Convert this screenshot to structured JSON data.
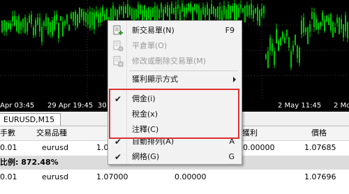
{
  "chart": {
    "time_labels": [
      "Apr 03:45",
      "29 Apr 19:45",
      "30",
      "2 May 11:45",
      "2 Mo"
    ]
  },
  "tab": {
    "label": "EURUSD,M15"
  },
  "table": {
    "headers": [
      "手數",
      "交易品種",
      "",
      "獲利",
      "價格"
    ],
    "rows": [
      [
        "0.01",
        "eurusd",
        "1.0",
        "",
        "1.07685"
      ],
      [
        "0.01",
        "eurusd",
        "1.07000",
        "0.00000",
        "1.07696"
      ]
    ],
    "ratio_label": "比例: 872.48%",
    "row1_extra": "0.00000",
    "row1_extra2": "0.00000"
  },
  "menu": {
    "items": [
      {
        "label": "新交易單(N)",
        "shortcut": "F9",
        "icon": "new-order-icon",
        "enabled": true
      },
      {
        "label": "平倉單(O)",
        "shortcut": "",
        "icon": "close-order-icon",
        "enabled": false
      },
      {
        "label": "修改或刪除交易單(M)",
        "shortcut": "",
        "icon": "modify-order-icon",
        "enabled": false
      },
      {
        "label": "獲利顯示方式",
        "shortcut": "",
        "submenu": true,
        "enabled": true
      },
      {
        "label": "佣金(i)",
        "checked": true,
        "enabled": true
      },
      {
        "label": "稅金(x)",
        "checked": false,
        "enabled": true
      },
      {
        "label": "注釋(C)",
        "checked": false,
        "enabled": true
      },
      {
        "label": "自動排列(A)",
        "shortcut": "A",
        "checked": true,
        "enabled": true
      },
      {
        "label": "網格(G)",
        "shortcut": "G",
        "checked": true,
        "enabled": true
      }
    ]
  },
  "colors": {
    "candle_up": "#00c800",
    "highlight": "#e03030"
  }
}
